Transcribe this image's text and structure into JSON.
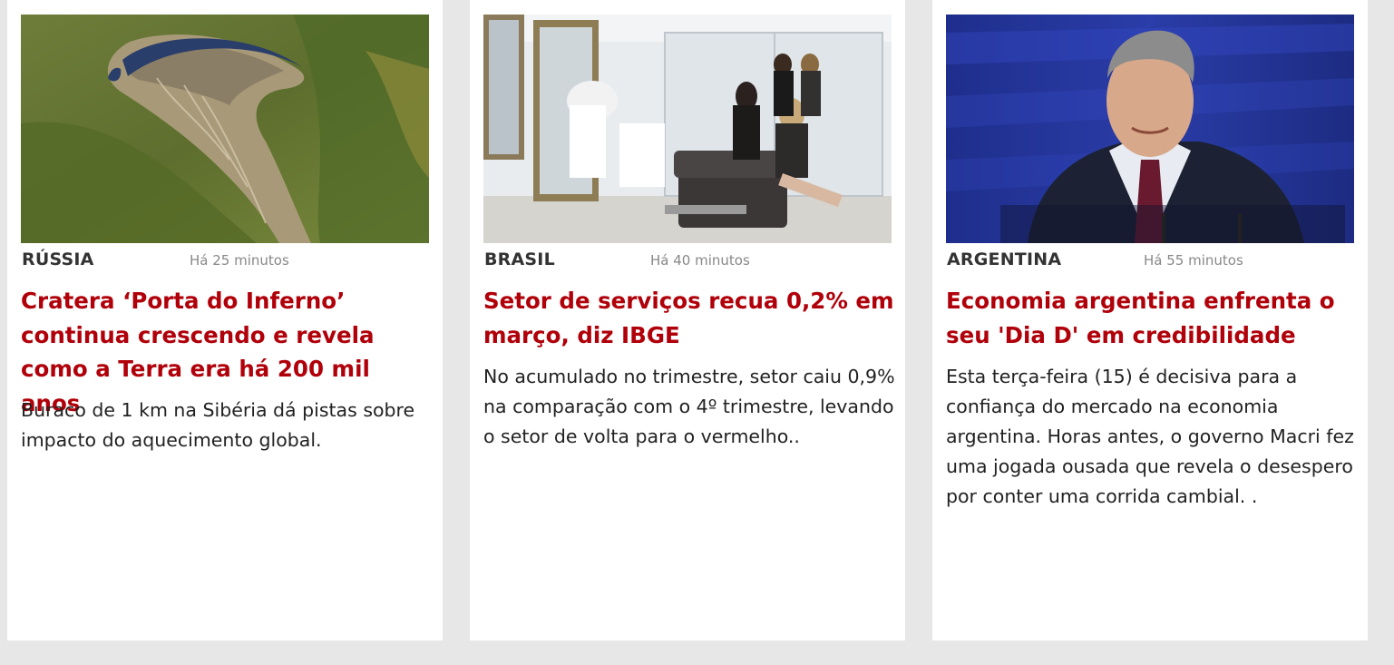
{
  "articles": [
    {
      "category": "RÚSSIA",
      "time": "Há 25 minutos",
      "headline": "Cratera ‘Porta do Inferno’ continua crescendo e revela como a Terra era há 200 mil anos",
      "summary": "Buraco de 1 km na Sibéria dá pistas sobre impacto do aquecimento global."
    },
    {
      "category": "BRASIL",
      "time": "Há 40 minutos",
      "headline": "Setor de serviços recua 0,2% em março, diz IBGE",
      "summary": "No acumulado no trimestre, setor caiu 0,9% na comparação com o 4º trimestre, levando o setor de volta para o vermelho.."
    },
    {
      "category": "ARGENTINA",
      "time": "Há 55 minutos",
      "headline": "Economia argentina enfrenta o seu 'Dia D' em credibilidade",
      "summary": "Esta terça-feira (15) é decisiva para a confiança do mercado na economia argentina. Horas antes, o governo Macri fez uma jogada ousada que revela o desespero por conter uma corrida cambial. ."
    }
  ],
  "colors": {
    "page_background": "#e7e7e7",
    "card_background": "#ffffff",
    "headline": "#b0000a",
    "category": "#333333",
    "time": "#888888",
    "summary": "#222222"
  }
}
